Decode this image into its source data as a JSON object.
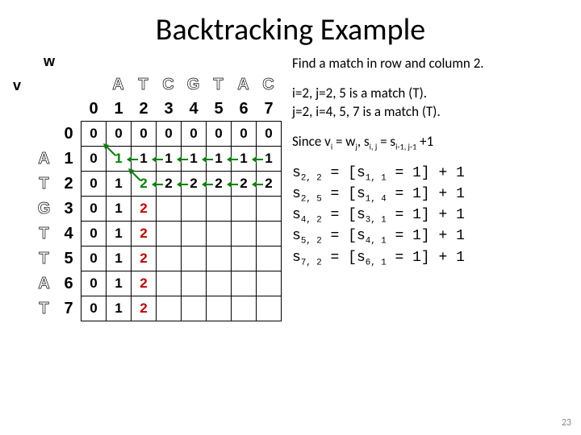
{
  "title": "Backtracking Example",
  "w_label": "w",
  "v_label": "v",
  "w_seq": [
    "A",
    "T",
    "C",
    "G",
    "T",
    "A",
    "C"
  ],
  "v_seq": [
    "A",
    "T",
    "G",
    "T",
    "T",
    "A",
    "T"
  ],
  "col_idx": [
    "0",
    "1",
    "2",
    "3",
    "4",
    "5",
    "6",
    "7"
  ],
  "row_idx": [
    "0",
    "1",
    "2",
    "3",
    "4",
    "5",
    "6",
    "7"
  ],
  "grid": [
    [
      "0",
      "0",
      "0",
      "0",
      "0",
      "0",
      "0",
      "0"
    ],
    [
      "0",
      "1",
      "1",
      "1",
      "1",
      "1",
      "1",
      "1"
    ],
    [
      "0",
      "1",
      "2",
      "2",
      "2",
      "2",
      "2",
      "2"
    ],
    [
      "0",
      "1",
      "2",
      "",
      "",
      "",
      "",
      ""
    ],
    [
      "0",
      "1",
      "2",
      "",
      "",
      "",
      "",
      ""
    ],
    [
      "0",
      "1",
      "2",
      "",
      "",
      "",
      "",
      ""
    ],
    [
      "0",
      "1",
      "2",
      "",
      "",
      "",
      "",
      ""
    ],
    [
      "0",
      "1",
      "2",
      "",
      "",
      "",
      "",
      ""
    ]
  ],
  "arrows": {
    "diag": [
      [
        1,
        1
      ],
      [
        2,
        2
      ]
    ],
    "horz": [
      [
        1,
        2
      ],
      [
        1,
        3
      ],
      [
        1,
        4
      ],
      [
        1,
        5
      ],
      [
        1,
        6
      ],
      [
        1,
        7
      ],
      [
        2,
        3
      ],
      [
        2,
        4
      ],
      [
        2,
        5
      ],
      [
        2,
        6
      ],
      [
        2,
        7
      ]
    ]
  },
  "red_cells": [
    [
      2,
      2
    ],
    [
      3,
      2
    ],
    [
      4,
      2
    ],
    [
      5,
      2
    ],
    [
      6,
      2
    ],
    [
      7,
      2
    ]
  ],
  "text": {
    "l1": "Find a match in row and column 2.",
    "l2": "i=2, j=2, 5 is a match (T).",
    "l3": "j=2, i=4, 5, 7 is a match (T)."
  },
  "formula": {
    "pre": "Since v",
    "sub1": "i",
    "mid1": " = w",
    "sub2": "j",
    "mid2": ", s",
    "sub3": "i, j",
    "mid3": " = s",
    "sub4": "i-1, j-1",
    "post": " +1"
  },
  "equations": [
    {
      "l": "s",
      "ls": "2, 2",
      "a": "[s",
      "as": "1, 1",
      "b": "1]",
      "c": "1"
    },
    {
      "l": "s",
      "ls": "2, 5",
      "a": "[s",
      "as": "1, 4",
      "b": "1]",
      "c": "1"
    },
    {
      "l": "s",
      "ls": "4, 2",
      "a": "[s",
      "as": "3, 1",
      "b": "1]",
      "c": "1"
    },
    {
      "l": "s",
      "ls": "5, 2",
      "a": "[s",
      "as": "4, 1",
      "b": "1]",
      "c": "1"
    },
    {
      "l": "s",
      "ls": "7, 2",
      "a": "[s",
      "as": "6, 1",
      "b": "1]",
      "c": "1"
    }
  ],
  "pagenum": "23"
}
